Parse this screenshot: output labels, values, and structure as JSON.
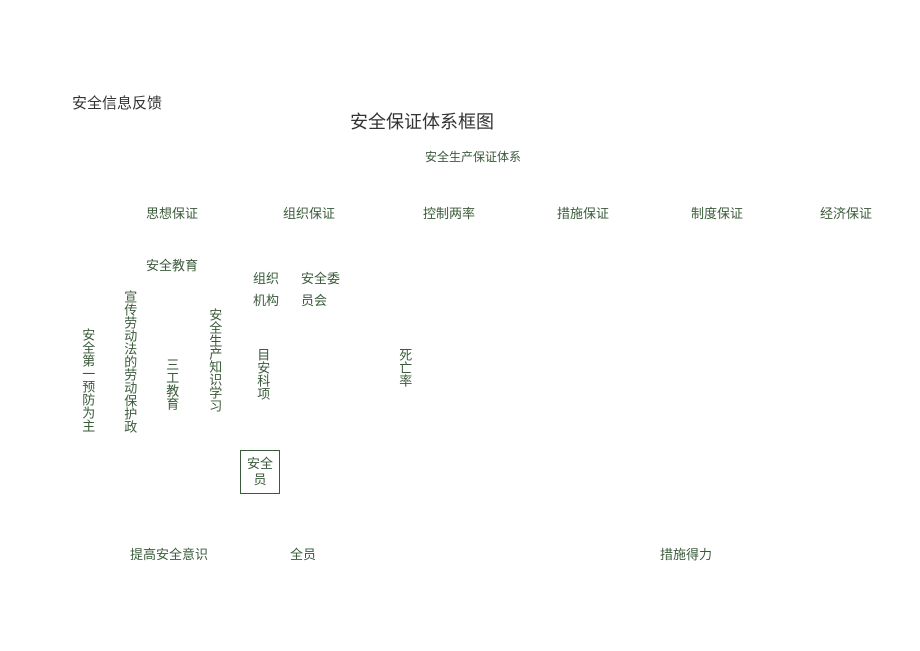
{
  "header": "安全信息反馈",
  "title": "安全保证体系框图",
  "subtitle": "安全生产保证体系",
  "level1": {
    "c1": "思想保证",
    "c2": "组织保证",
    "c3": "控制两率",
    "c4": "措施保证",
    "c5": "制度保证",
    "c6": "经济保证"
  },
  "safety_edu": "安全教育",
  "vertical": {
    "safety_first": "安全第一预防为主",
    "propaganda": "宣传劳动法的劳动保护政",
    "three_work": "三工教育",
    "knowledge": "安全生产知识学习",
    "target": "目安科项",
    "death_rate": "死亡率"
  },
  "org": {
    "jg1": "组织",
    "jg2": "机构",
    "sc1": "安全委",
    "sc2": "员会"
  },
  "box": {
    "safety_member": "安全员"
  },
  "bottom": {
    "awareness": "提高安全意识",
    "all_staff": "全员",
    "effective": "措施得力"
  }
}
